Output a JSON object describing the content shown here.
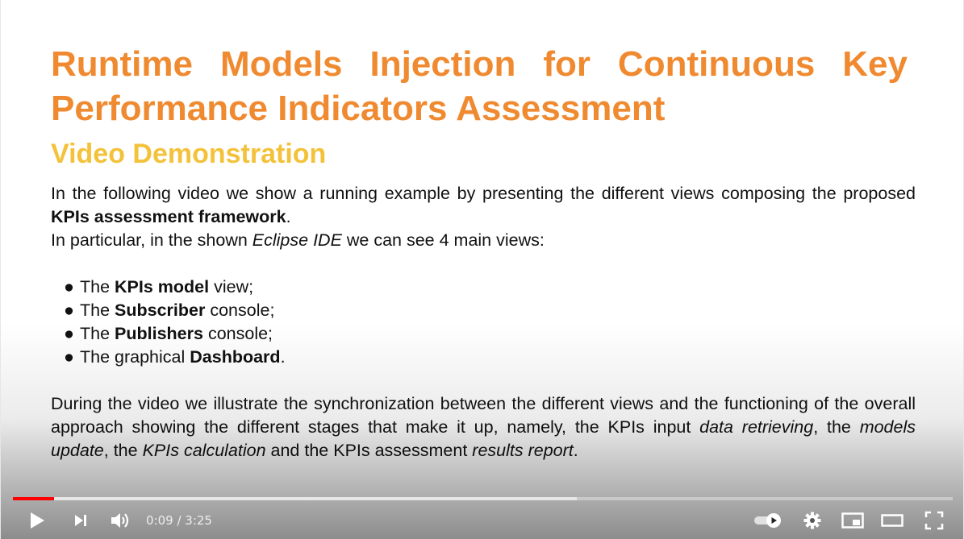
{
  "slide": {
    "title": "Runtime Models Injection for Continuous Key Performance Indicators Assessment",
    "subtitle": "Video Demonstration",
    "intro": {
      "t1": "In the following video we show a running example by presenting the different views composing the proposed ",
      "b1": "KPIs assessment framework",
      "t2": ".",
      "t3": "In particular, in the shown ",
      "i1": "Eclipse IDE",
      "t4": " we can see 4 main views:"
    },
    "views": [
      {
        "pre": "The ",
        "bold": "KPIs model",
        "post": " view;"
      },
      {
        "pre": "The ",
        "bold": "Subscriber",
        "post": " console;"
      },
      {
        "pre": "The ",
        "bold": "Publishers",
        "post": " console;"
      },
      {
        "pre": "The graphical ",
        "bold": "Dashboard",
        "post": "."
      }
    ],
    "bullet": "●",
    "closing": {
      "t1": "During the video we illustrate the synchronization between the different views and the functioning of the overall approach showing the different stages that make it up, namely, the KPIs input ",
      "i1": "data retrieving",
      "t2": ", the ",
      "i2": "models update",
      "t3": ", the ",
      "i3": "KPIs calculation",
      "t4": " and the KPIs assessment ",
      "i4": "results report",
      "t5": "."
    }
  },
  "colors": {
    "title": "#f08a30",
    "subtitle": "#f4c23a",
    "progress_played": "#ff0000"
  },
  "player": {
    "time": "0:09 / 3:25",
    "progress_played_fraction": 0.044,
    "progress_buffered_fraction": 0.6,
    "icons": [
      "play-icon",
      "next-icon",
      "volume-icon",
      "autoplay-toggle-icon",
      "settings-icon",
      "miniplayer-icon",
      "theater-icon",
      "fullscreen-icon"
    ]
  }
}
